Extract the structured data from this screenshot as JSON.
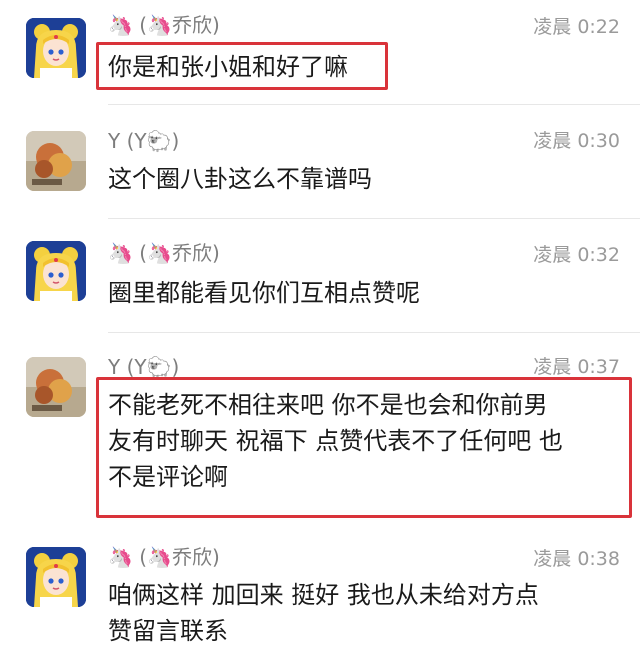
{
  "messages": [
    {
      "sender": "🦄 (🦄乔欣)",
      "time": "凌晨 0:22",
      "lines": [
        "你是和张小姐和好了嘛"
      ],
      "avatar": "sailor-moon-avatar"
    },
    {
      "sender": "Y (Y🐑)",
      "time": "凌晨 0:30",
      "lines": [
        "这个圈八卦这么不靠谱吗"
      ],
      "avatar": "photo-avatar"
    },
    {
      "sender": "🦄 (🦄乔欣)",
      "time": "凌晨 0:32",
      "lines": [
        "圈里都能看见你们互相点赞呢"
      ],
      "avatar": "sailor-moon-avatar"
    },
    {
      "sender": "Y (Y🐑)",
      "time": "凌晨 0:37",
      "lines": [
        "不能老死不相往来吧 你不是也会和你前男",
        "友有时聊天 祝福下 点赞代表不了任何吧 也",
        "不是评论啊"
      ],
      "avatar": "photo-avatar"
    },
    {
      "sender": "🦄 (🦄乔欣)",
      "time": "凌晨 0:38",
      "lines": [
        "咱俩这样 加回来 挺好 我也从未给对方点",
        "赞留言联系"
      ],
      "avatar": "sailor-moon-avatar"
    }
  ],
  "colors": {
    "highlight": "#d9333a",
    "name_text": "#7d7d7d",
    "time_text": "#9a9a9a",
    "body_text": "#1a1a1a"
  }
}
